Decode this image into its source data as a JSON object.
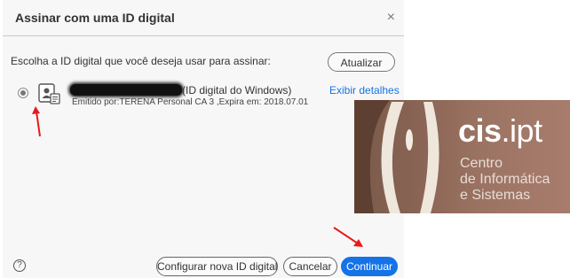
{
  "dialog": {
    "title": "Assinar com uma ID digital",
    "close": "×",
    "prompt": "Escolha a ID digital que você deseja usar para assinar:",
    "refresh_label": "Atualizar",
    "certificate": {
      "name_suffix": "(ID digital do Windows)",
      "issuer": "Emitido por:TERENA Personal CA 3 ,Expira em: 2018.07.01",
      "selected": true
    },
    "details_link": "Exibir detalhes",
    "help": "?",
    "buttons": {
      "configure": "Configurar nova ID digital",
      "cancel": "Cancelar",
      "continue": "Continuar"
    }
  },
  "logo": {
    "brand_bold": "cis",
    "brand_light": ".ipt",
    "line1": "Centro",
    "line2": "de Informática",
    "line3": "e Sistemas"
  },
  "colors": {
    "accent": "#1473e6",
    "annotation_arrow": "#e8191b",
    "logo_background": "#8c6656"
  },
  "icons": {
    "certificate": "certificate-id-icon",
    "help": "help-circle-icon",
    "close": "close-icon"
  }
}
